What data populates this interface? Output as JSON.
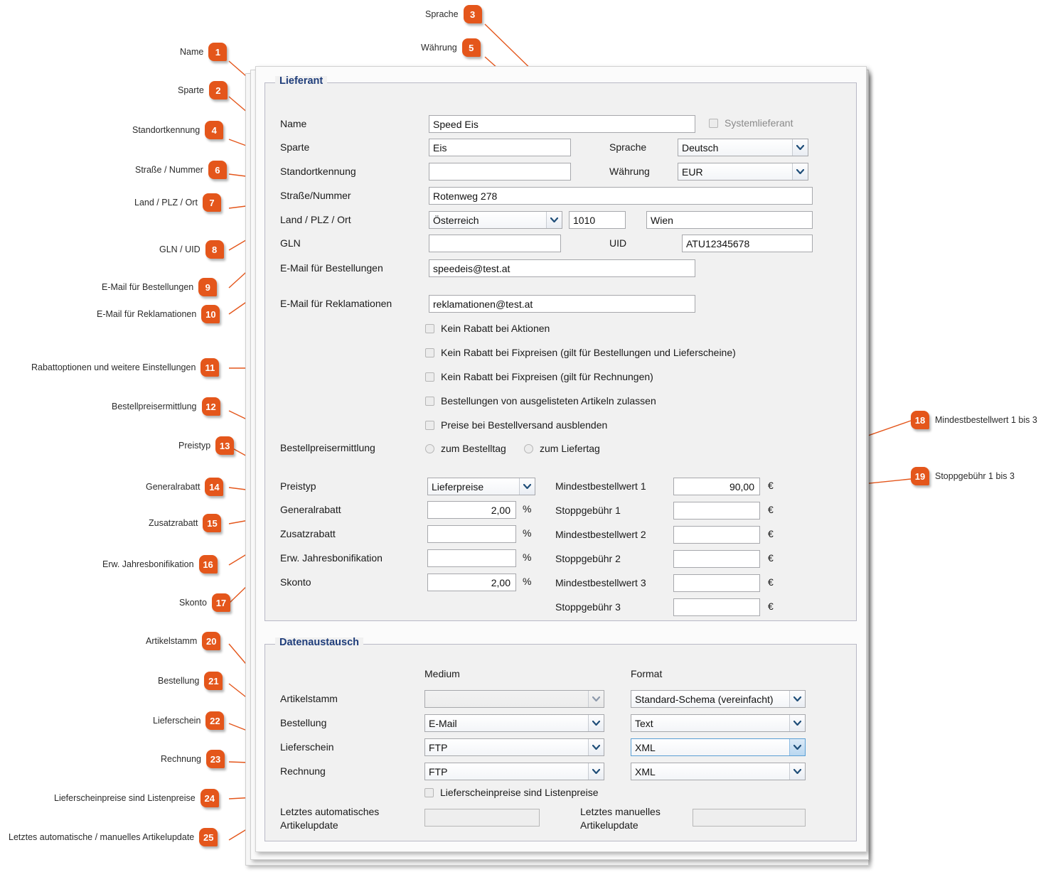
{
  "theme": {
    "badge_color": "#e4561b",
    "legend_color": "#1f3d7a",
    "panel_bg": "#f1f1f1"
  },
  "panel": {
    "groups": {
      "lieferant": "Lieferant",
      "datenaustausch": "Datenaustausch"
    },
    "lieferant": {
      "fields": {
        "name_label": "Name",
        "name_value": "Speed Eis",
        "systemlieferant_label": "Systemlieferant",
        "sparte_label": "Sparte",
        "sparte_value": "Eis",
        "sprache_label": "Sprache",
        "sprache_value": "Deutsch",
        "standortkennung_label": "Standortkennung",
        "standortkennung_value": "",
        "waehrung_label": "Währung",
        "waehrung_value": "EUR",
        "strasse_label": "Straße/Nummer",
        "strasse_value": "Rotenweg 278",
        "land_label": "Land / PLZ / Ort",
        "land_value": "Österreich",
        "plz_value": "1010",
        "ort_value": "Wien",
        "gln_label": "GLN",
        "gln_value": "",
        "uid_label": "UID",
        "uid_value": "ATU12345678",
        "email_bestellungen_label": "E-Mail für Bestellungen",
        "email_bestellungen_value": "speedeis@test.at",
        "email_reklamationen_label": "E-Mail für Reklamationen",
        "email_reklamationen_value": "reklamationen@test.at"
      },
      "checkboxes": [
        "Kein Rabatt bei Aktionen",
        "Kein Rabatt bei Fixpreisen (gilt für Bestellungen und Lieferscheine)",
        "Kein Rabatt bei Fixpreisen (gilt für Rechnungen)",
        "Bestellungen von ausgelisteten Artikeln zulassen",
        "Preise bei Bestellversand ausblenden"
      ],
      "bestellpreisermittlung": {
        "label": "Bestellpreisermittlung",
        "options": [
          "zum Bestelltag",
          "zum Liefertag"
        ]
      },
      "preistyp": {
        "label": "Preistyp",
        "value": "Lieferpreise"
      },
      "percent_rows": [
        {
          "label": "Generalrabatt",
          "value": "2,00",
          "unit": "%"
        },
        {
          "label": "Zusatzrabatt",
          "value": "",
          "unit": "%"
        },
        {
          "label": "Erw. Jahresbonifikation",
          "value": "",
          "unit": "%"
        },
        {
          "label": "Skonto",
          "value": "2,00",
          "unit": "%"
        }
      ],
      "euro_rows": [
        {
          "label": "Mindestbestellwert 1",
          "value": "90,00",
          "unit": "€"
        },
        {
          "label": "Stoppgebühr 1",
          "value": "",
          "unit": "€"
        },
        {
          "label": "Mindestbestellwert 2",
          "value": "",
          "unit": "€"
        },
        {
          "label": "Stoppgebühr 2",
          "value": "",
          "unit": "€"
        },
        {
          "label": "Mindestbestellwert 3",
          "value": "",
          "unit": "€"
        },
        {
          "label": "Stoppgebühr 3",
          "value": "",
          "unit": "€"
        }
      ]
    },
    "datenaustausch": {
      "col_medium": "Medium",
      "col_format": "Format",
      "rows": [
        {
          "label": "Artikelstamm",
          "medium": "",
          "format": "Standard-Schema (vereinfacht)"
        },
        {
          "label": "Bestellung",
          "medium": "E-Mail",
          "format": "Text"
        },
        {
          "label": "Lieferschein",
          "medium": "FTP",
          "format": "XML"
        },
        {
          "label": "Rechnung",
          "medium": "FTP",
          "format": "XML"
        }
      ],
      "listenpreise_label": "Lieferscheinpreise sind Listenpreise",
      "auto_update_label": "Letztes automatisches\nArtikelupdate",
      "auto_update_label_1": "Letztes automatisches",
      "auto_update_label_2": "Artikelupdate",
      "auto_update_value": "",
      "manual_update_label_1": "Letztes manuelles",
      "manual_update_label_2": "Artikelupdate",
      "manual_update_value": ""
    }
  },
  "annotations": [
    {
      "n": "1",
      "text": "Name"
    },
    {
      "n": "2",
      "text": "Sparte"
    },
    {
      "n": "3",
      "text": "Sprache"
    },
    {
      "n": "4",
      "text": "Standortkennung"
    },
    {
      "n": "5",
      "text": "Währung"
    },
    {
      "n": "6",
      "text": "Straße / Nummer"
    },
    {
      "n": "7",
      "text": "Land / PLZ / Ort"
    },
    {
      "n": "8",
      "text": "GLN / UID"
    },
    {
      "n": "9",
      "text": "E-Mail für Bestellungen"
    },
    {
      "n": "10",
      "text": "E-Mail für Reklamationen"
    },
    {
      "n": "11",
      "text": "Rabattoptionen und weitere Einstellungen"
    },
    {
      "n": "12",
      "text": "Bestellpreisermittlung"
    },
    {
      "n": "13",
      "text": "Preistyp"
    },
    {
      "n": "14",
      "text": "Generalrabatt"
    },
    {
      "n": "15",
      "text": "Zusatzrabatt"
    },
    {
      "n": "16",
      "text": "Erw. Jahresbonifikation"
    },
    {
      "n": "17",
      "text": "Skonto"
    },
    {
      "n": "18",
      "text": "Mindestbestellwert 1 bis 3"
    },
    {
      "n": "19",
      "text": "Stoppgebühr 1 bis 3"
    },
    {
      "n": "20",
      "text": "Artikelstamm"
    },
    {
      "n": "21",
      "text": "Bestellung"
    },
    {
      "n": "22",
      "text": "Lieferschein"
    },
    {
      "n": "23",
      "text": "Rechnung"
    },
    {
      "n": "24",
      "text": "Lieferscheinpreise sind Listenpreise"
    },
    {
      "n": "25",
      "text": "Letztes automatische / manuelles Artikelupdate"
    }
  ]
}
